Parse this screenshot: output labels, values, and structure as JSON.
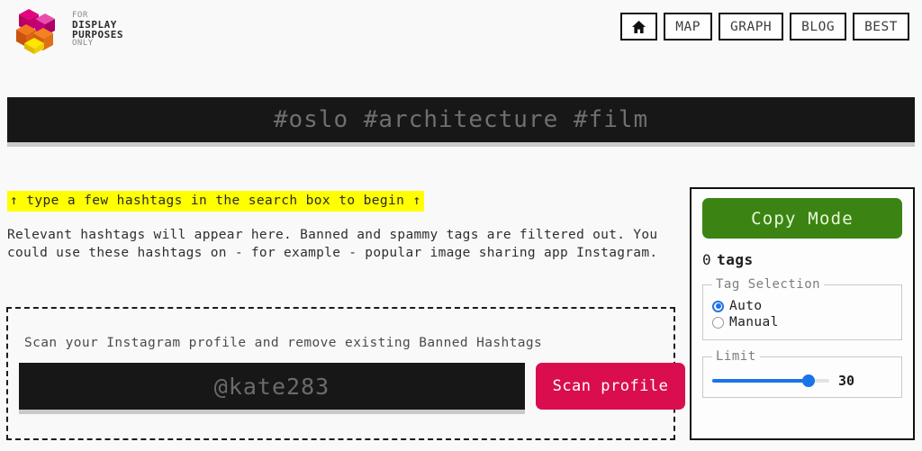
{
  "brand": {
    "logo_lines": [
      "FOR",
      "DISPLAY",
      "PURPOSES",
      "ONLY"
    ],
    "logo_colors": [
      "#e5007d",
      "#f07f13",
      "#f5e100",
      "#d6006e"
    ]
  },
  "nav": {
    "items": [
      {
        "label": "",
        "icon": "home-icon",
        "name": "nav-home"
      },
      {
        "label": "MAP",
        "icon": "",
        "name": "nav-map"
      },
      {
        "label": "GRAPH",
        "icon": "",
        "name": "nav-graph"
      },
      {
        "label": "BLOG",
        "icon": "",
        "name": "nav-blog"
      },
      {
        "label": "BEST",
        "icon": "",
        "name": "nav-best"
      }
    ]
  },
  "search": {
    "value": "",
    "placeholder": "#oslo #architecture #film"
  },
  "main": {
    "hint": "↑ type a few hashtags in the search box to begin ↑",
    "blurb": "Relevant hashtags will appear here. Banned and spammy tags are filtered out. You could use these hashtags on - for example - popular image sharing app Instagram.",
    "scan": {
      "label": "Scan your Instagram profile and remove existing Banned Hashtags",
      "username_value": "",
      "username_placeholder": "@kate283",
      "button_label": "Scan profile",
      "button_color": "#da0e4f"
    }
  },
  "sidebar": {
    "copy_mode_label": "Copy Mode",
    "copy_mode_color": "#3b8413",
    "tag_count_number": "0",
    "tag_count_word": "tags",
    "tag_selection": {
      "legend": "Tag Selection",
      "options": [
        {
          "label": "Auto",
          "selected": true
        },
        {
          "label": "Manual",
          "selected": false
        }
      ]
    },
    "limit": {
      "legend": "Limit",
      "value": "30",
      "accent": "#1a73e8"
    }
  }
}
